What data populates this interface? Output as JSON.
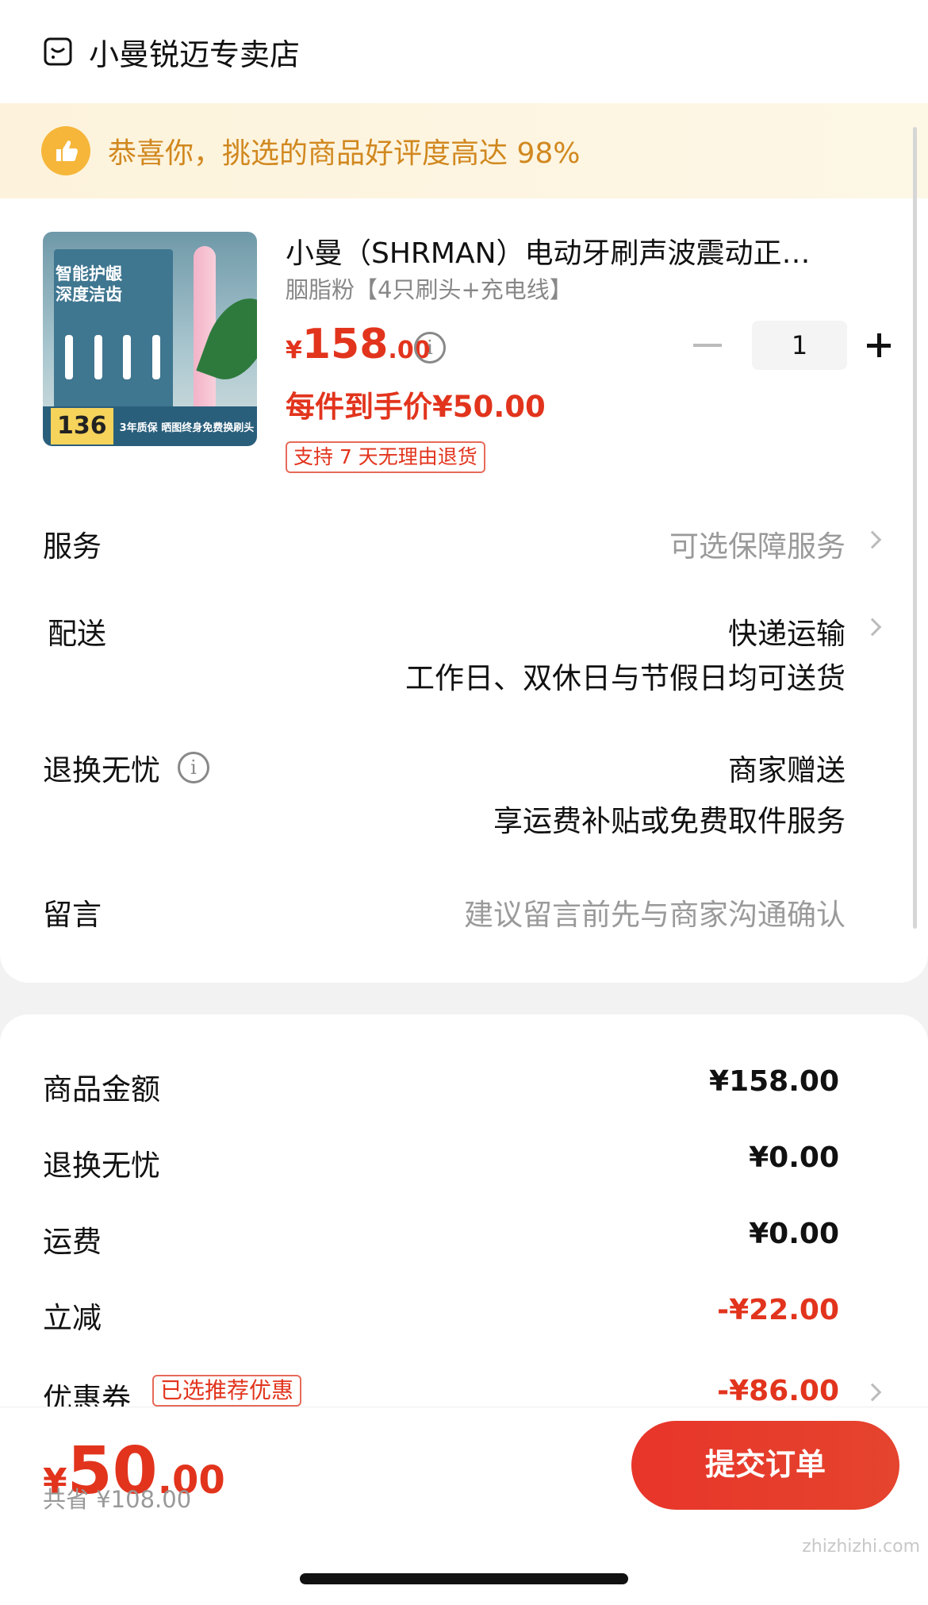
{
  "shop": {
    "name": "小曼锐迈专卖店",
    "icon": "shop-icon"
  },
  "banner": {
    "text": "恭喜你，挑选的商品好评度高达 98%",
    "icon": "thumbs-up-icon"
  },
  "product": {
    "image_texts": {
      "headline": "智能护龈\n深度洁齿",
      "price_tag": "136",
      "promo": "3年质保 晒图终身免费换刷头"
    },
    "title": "小曼（SHRMAN）电动牙刷声波震动正…",
    "variant": "胭脂粉【4只刷头+充电线】",
    "price": {
      "currency": "¥",
      "integer": "158",
      "decimal": ".00"
    },
    "final_price": "每件到手价¥50.00",
    "return_tag": "支持 7 天无理由退货",
    "quantity": "1"
  },
  "rows": {
    "service": {
      "label": "服务",
      "value": "可选保障服务"
    },
    "delivery": {
      "label": "配送",
      "value": "快递运输",
      "sub": "工作日、双休日与节假日均可送货"
    },
    "returns": {
      "label": "退换无忧",
      "value": "商家赠送",
      "sub": "享运费补贴或免费取件服务"
    },
    "message": {
      "label": "留言",
      "placeholder": "建议留言前先与商家沟通确认"
    }
  },
  "summary": [
    {
      "label": "商品金额",
      "value": "¥158.00"
    },
    {
      "label": "退换无忧",
      "value": "¥0.00"
    },
    {
      "label": "运费",
      "value": "¥0.00"
    },
    {
      "label": "立减",
      "value": "-¥22.00"
    },
    {
      "label": "优惠券",
      "value": "-¥86.00",
      "badge": "已选推荐优惠"
    }
  ],
  "footer": {
    "total": {
      "currency": "¥",
      "integer": "50",
      "decimal": ".00"
    },
    "saved": "共省 ¥108.00",
    "submit_label": "提交订单"
  },
  "watermark": "zhizhizhi.com",
  "colors": {
    "accent": "#e2341d",
    "banner_bg": "#fdf3dc",
    "banner_text": "#d1881f"
  }
}
